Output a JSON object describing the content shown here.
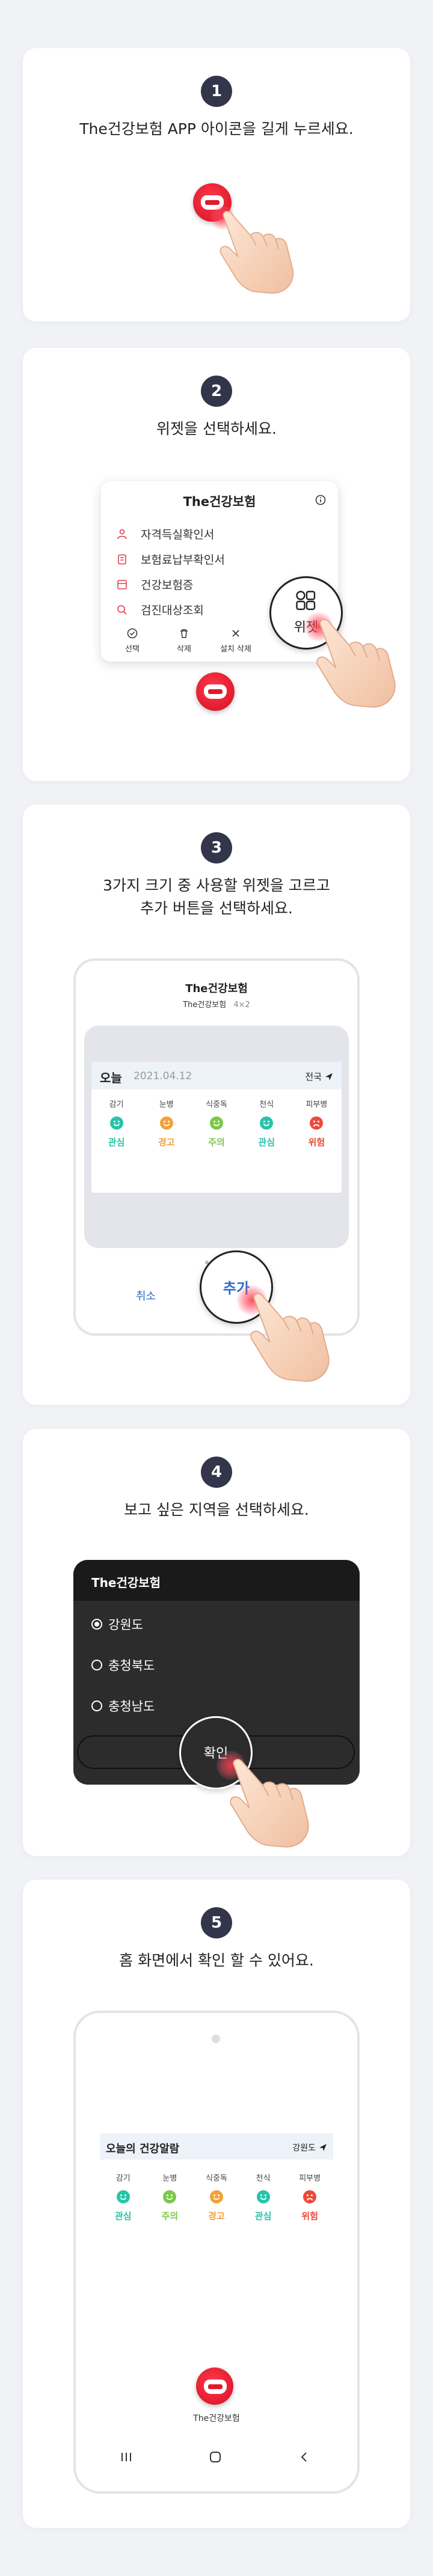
{
  "steps": [
    {
      "num": "1",
      "title": "The건강보험 APP 아이콘을 길게 누르세요."
    },
    {
      "num": "2",
      "title": "위젯을 선택하세요."
    },
    {
      "num": "3",
      "title_line1": "3가지 크기 중 사용할 위젯을 고르고",
      "title_line2": "추가 버튼을 선택하세요."
    },
    {
      "num": "4",
      "title": "보고 싶은 지역을 선택하세요."
    },
    {
      "num": "5",
      "title": "홈 화면에서 확인 할 수 있어요."
    }
  ],
  "popup": {
    "title": "The건강보험",
    "items": [
      "자격득실확인서",
      "보험료납부확인서",
      "건강보험증",
      "검진대상조회"
    ],
    "actions": [
      "선택",
      "삭제",
      "설치 삭제"
    ],
    "widget_label": "위젯"
  },
  "widget_picker": {
    "title": "The건강보험",
    "subtitle": "The건강보험",
    "size": "4×2",
    "today": "오늘",
    "date": "2021.04.12",
    "region": "전국",
    "cancel": "취소",
    "add": "추가"
  },
  "forecast_step3": [
    {
      "label": "감기",
      "status": "관심",
      "color": "#27c4a8"
    },
    {
      "label": "눈병",
      "status": "경고",
      "color": "#f3a13a"
    },
    {
      "label": "식중독",
      "status": "주의",
      "color": "#7cc84a"
    },
    {
      "label": "천식",
      "status": "관심",
      "color": "#27c4a8"
    },
    {
      "label": "피부병",
      "status": "위험",
      "color": "#ec4a3a"
    }
  ],
  "region_dialog": {
    "title": "The건강보험",
    "options": [
      "강원도",
      "충청북도",
      "충청남도"
    ],
    "selected_index": 0,
    "confirm": "확인"
  },
  "home_widget": {
    "title": "오늘의 건강알람",
    "region": "강원도",
    "forecast": [
      {
        "label": "감기",
        "status": "관심",
        "color": "#27c4a8"
      },
      {
        "label": "눈병",
        "status": "주의",
        "color": "#7cc84a"
      },
      {
        "label": "식중독",
        "status": "경고",
        "color": "#f3a13a"
      },
      {
        "label": "천식",
        "status": "관심",
        "color": "#27c4a8"
      },
      {
        "label": "피부병",
        "status": "위험",
        "color": "#ec4a3a"
      }
    ],
    "app_name": "The건강보험"
  },
  "icons": [
    "heart-app-icon",
    "person-icon",
    "receipt-icon",
    "card-icon",
    "search-icon",
    "check-circle-icon",
    "trash-icon",
    "close-icon",
    "widget-grid-icon",
    "info-icon",
    "send-arrow-icon",
    "recent-apps-icon",
    "home-icon",
    "back-icon",
    "pointing-hand-icon"
  ]
}
